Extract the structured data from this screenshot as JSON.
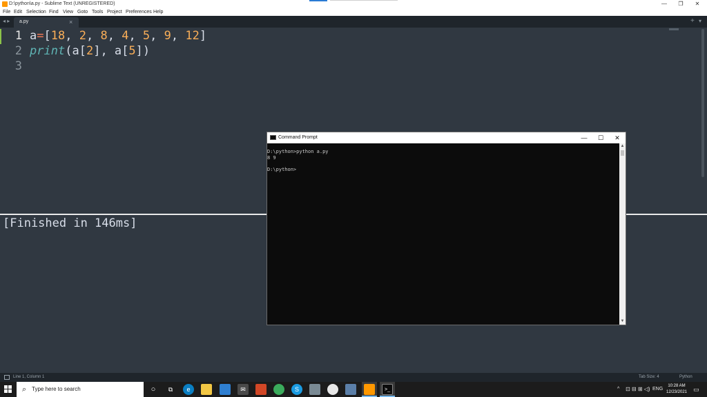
{
  "window": {
    "title": "D:\\python\\a.py - Sublime Text (UNREGISTERED)",
    "controls": {
      "minimize": "—",
      "restore": "❐",
      "close": "✕"
    }
  },
  "menu": {
    "items": [
      "File",
      "Edit",
      "Selection",
      "Find",
      "View",
      "Goto",
      "Tools",
      "Project",
      "Preferences",
      "Help"
    ]
  },
  "tabs": {
    "nav_arrows": "◂ ▸",
    "active_tab": "a.py",
    "close_glyph": "×",
    "new_tab_glyph": "+",
    "dropdown_glyph": "▾"
  },
  "editor": {
    "lines": [
      {
        "number": "1",
        "active": true
      },
      {
        "number": "2",
        "active": false
      },
      {
        "number": "3",
        "active": false
      }
    ],
    "code": {
      "line1": {
        "var": "a",
        "op": "=",
        "open": "[",
        "nums": [
          "18",
          "2",
          "8",
          "4",
          "5",
          "9",
          "12"
        ],
        "close": "]"
      },
      "line2": {
        "fn": "print",
        "open": "(",
        "arg1_var": "a",
        "arg1_idx": "2",
        "sep": ", ",
        "arg2_var": "a",
        "arg2_idx": "5",
        "close": ")"
      }
    }
  },
  "output": {
    "text": "[Finished in 146ms]"
  },
  "statusbar": {
    "position": "Line 1, Column 1",
    "tab_size": "Tab Size: 4",
    "syntax": "Python"
  },
  "cmd": {
    "title": "Command Prompt",
    "controls": {
      "minimize": "—",
      "maximize": "☐",
      "close": "✕"
    },
    "lines": [
      "D:\\python>python a.py",
      "8 9",
      "",
      "D:\\python>"
    ],
    "scroll_up": "▲",
    "scroll_down": "▼"
  },
  "taskbar": {
    "search_placeholder": "Type here to search",
    "search_icon": "magnifier-icon",
    "tray": {
      "chevron": "^",
      "language": "ENG"
    },
    "clock": {
      "time": "10:28 AM",
      "date": "12/23/2021"
    },
    "icons": [
      "cortana-icon",
      "task-view-icon",
      "edge-icon",
      "file-explorer-icon",
      "store-icon",
      "mail-icon",
      "office-icon",
      "chrome-icon",
      "skype-icon",
      "settings-icon",
      "onedrive-icon",
      "app-icon",
      "sublime-icon",
      "cmd-icon"
    ]
  },
  "colors": {
    "editor_bg": "#303841",
    "keyword_op": "#f97b57",
    "number": "#f9ae58",
    "function": "#5fb4b4",
    "text": "#d8dee9",
    "active_line_marker": "#8bc34a"
  }
}
